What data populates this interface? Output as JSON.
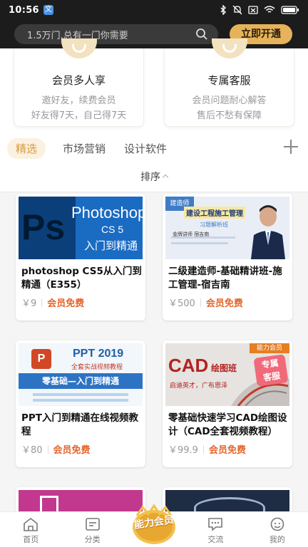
{
  "status_bar": {
    "time": "10:56",
    "app_badge": "文"
  },
  "header": {
    "search_placeholder": "1.5万门,总有一门你需要",
    "open_button": "立即开通"
  },
  "benefits": [
    {
      "title": "会员多人享",
      "line1": "邀好友，续费会员",
      "line2": "好友得7天，自己得7天",
      "icon": "group-icon"
    },
    {
      "title": "专属客服",
      "line1": "会员问题耐心解答",
      "line2": "售后不愁有保障",
      "icon": "service-icon"
    }
  ],
  "tabs": [
    "精选",
    "市场营销",
    "设计软件"
  ],
  "sort_label": "排序",
  "courses": [
    {
      "title": "photoshop CS5从入门到精通（E355）",
      "price": "￥9",
      "badge": "会员免费",
      "thumb": {
        "big": "Ps",
        "line1": "Photoshop",
        "line2": "CS 5",
        "line3": "入门到精通",
        "bg": "#1b6fc4"
      }
    },
    {
      "title": "二级建造师-基础精讲班-施工管理-宿吉南",
      "price": "￥500",
      "badge": "会员免费",
      "thumb": {
        "corner": "建造师",
        "headline": "建设工程施工管理",
        "sub": "习题解析班",
        "tag": "金牌讲师  宿吉南",
        "bg": "#e9eef6"
      }
    },
    {
      "title": "PPT入门到精通在线视频教程",
      "price": "￥80",
      "badge": "会员免费",
      "thumb": {
        "head": "PPT 2019",
        "sub": "全套实战视频教程",
        "slogan": "零基础—入门到精通",
        "bg": "#f2f7fb"
      }
    },
    {
      "title": "零基础快速学习CAD绘图设计（CAD全套视频教程）",
      "price": "￥99.9",
      "badge": "会员免费",
      "thumb": {
        "big": "CAD",
        "small": "绘图班",
        "slogan": "启迪英才，广布恩泽",
        "ribbon": "能力会员",
        "stamp1": "专属",
        "stamp2": "客服",
        "bg": "#2b2b2b"
      }
    }
  ],
  "bottom_nav": [
    {
      "label": "首页",
      "icon": "home-icon"
    },
    {
      "label": "分类",
      "icon": "category-icon"
    },
    {
      "label": "能力会员",
      "icon": "vip-center-icon"
    },
    {
      "label": "交流",
      "icon": "chat-icon"
    },
    {
      "label": "我的",
      "icon": "profile-icon"
    }
  ],
  "colors": {
    "accent": "#e6b35a",
    "free": "#e4652a",
    "tab_active": "#d89a3b",
    "dark": "#1c1c1c"
  }
}
